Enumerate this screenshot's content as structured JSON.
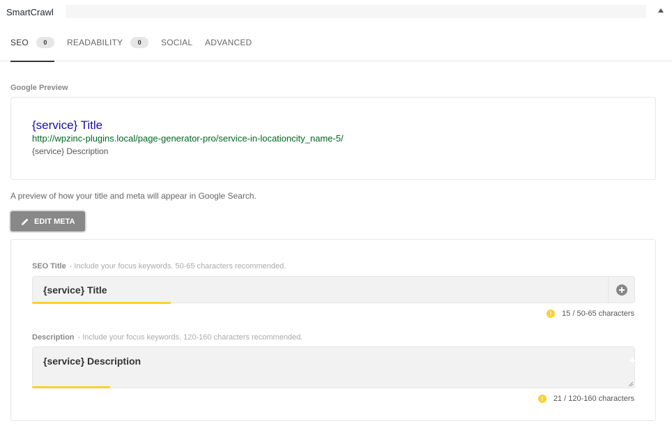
{
  "panel": {
    "title": "SmartCrawl"
  },
  "tabs": [
    {
      "label": "SEO",
      "count": "0"
    },
    {
      "label": "READABILITY",
      "count": "0"
    },
    {
      "label": "SOCIAL"
    },
    {
      "label": "ADVANCED"
    }
  ],
  "preview": {
    "heading": "Google Preview",
    "title": "{service} Title",
    "url": "http://wpzinc-plugins.local/page-generator-pro/service-in-locationcity_name-5/",
    "description": "{service} Description",
    "help": "A preview of how your title and meta will appear in Google Search."
  },
  "edit_button": {
    "label": "EDIT META",
    "icon": "pencil-icon"
  },
  "seo_title": {
    "label": "SEO Title",
    "hint": "- Include your focus keywords. 50-65 characters recommended.",
    "value": "{service} Title",
    "counter": "15 / 50-65 characters",
    "progress": 0.23
  },
  "description": {
    "label": "Description",
    "hint": "- Include your focus keywords. 120-160 characters recommended.",
    "value": "{service} Description",
    "counter": "21 / 120-160 characters",
    "progress": 0.13
  },
  "colors": {
    "accent": "#fecf2f",
    "link_title": "#1a0dab",
    "link_url": "#006621"
  }
}
